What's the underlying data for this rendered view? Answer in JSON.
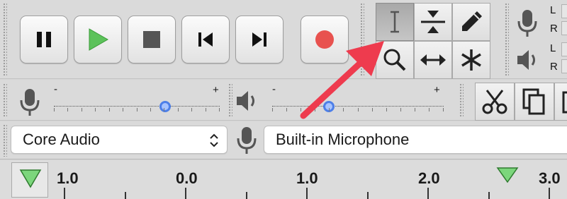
{
  "colors": {
    "play_green": "#5cc25a",
    "record_red": "#e8524f",
    "thumb_blue": "#4d7fe8",
    "arrow_red": "#ee3b4e",
    "play_head_green": "#7cd67c"
  },
  "transport": {
    "buttons": [
      {
        "name": "pause-button",
        "icon": "pause-icon"
      },
      {
        "name": "play-button",
        "icon": "play-icon"
      },
      {
        "name": "stop-button",
        "icon": "stop-icon"
      },
      {
        "name": "skip-to-start-button",
        "icon": "skip-start-icon"
      },
      {
        "name": "skip-to-end-button",
        "icon": "skip-end-icon"
      },
      {
        "name": "record-button",
        "icon": "record-icon"
      }
    ]
  },
  "tools": {
    "selected": "selection-tool",
    "items": [
      "selection-tool",
      "envelope-tool",
      "draw-tool",
      "zoom-tool",
      "time-shift-tool",
      "multi-tool"
    ]
  },
  "meters": {
    "record": {
      "left": "L",
      "right": "R"
    },
    "playback": {
      "left": "L",
      "right": "R"
    }
  },
  "mixer": {
    "input_volume": {
      "minus": "-",
      "plus": "+",
      "level": 0.67
    },
    "output_volume": {
      "minus": "-",
      "plus": "+",
      "level": 0.33
    }
  },
  "device": {
    "host": "Core Audio",
    "input_device": "Built-in Microphone"
  },
  "ruler": {
    "labels": [
      "1.0",
      "0.0",
      "1.0",
      "2.0",
      "3.0"
    ]
  }
}
